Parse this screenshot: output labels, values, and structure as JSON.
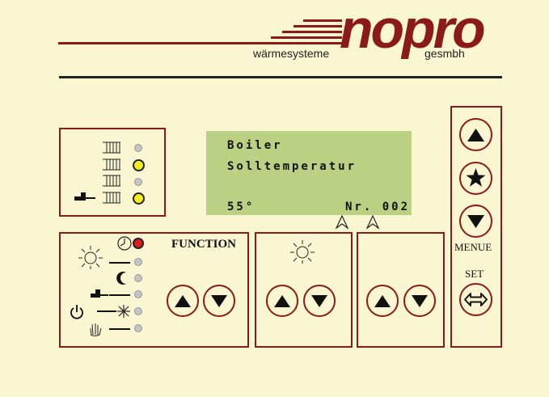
{
  "brand": {
    "name": "nopro",
    "subtitle_left": "wärmesysteme",
    "subtitle_right": "gesmbh",
    "color": "#8b1a1a"
  },
  "display": {
    "line1": "Boiler",
    "line2": "Solltemperatur",
    "temperature": "55°",
    "program": "Nr. 002",
    "background": "#bad183"
  },
  "function_panel": {
    "label": "FUNCTION",
    "icons": [
      "sun-icon",
      "clock-icon",
      "moon-icon",
      "tap-icon",
      "power-icon",
      "snowflake-icon",
      "hand-icon"
    ]
  },
  "right_panel": {
    "menu_label": "MENUE",
    "set_label": "SET"
  },
  "colors": {
    "led_on_yellow": "#f4ec1e",
    "led_on_red": "#e11a1a",
    "led_off": "#c4c4c4",
    "frame": "#8b1a1a"
  }
}
